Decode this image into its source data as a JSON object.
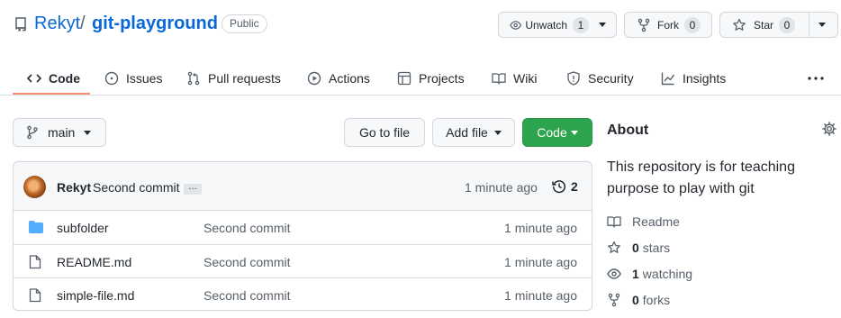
{
  "repo": {
    "owner": "Rekyt",
    "separator": "/",
    "name": "git-playground",
    "visibility": "Public"
  },
  "actions": {
    "watch_label": "Unwatch",
    "watch_count": "1",
    "fork_label": "Fork",
    "fork_count": "0",
    "star_label": "Star",
    "star_count": "0"
  },
  "nav": {
    "tabs": [
      {
        "label": "Code",
        "icon": "code-icon",
        "selected": true
      },
      {
        "label": "Issues",
        "icon": "issue-icon"
      },
      {
        "label": "Pull requests",
        "icon": "pull-request-icon"
      },
      {
        "label": "Actions",
        "icon": "play-icon"
      },
      {
        "label": "Projects",
        "icon": "table-icon"
      },
      {
        "label": "Wiki",
        "icon": "book-icon"
      },
      {
        "label": "Security",
        "icon": "shield-icon"
      },
      {
        "label": "Insights",
        "icon": "graph-icon"
      }
    ],
    "more_icon": "kebab-horizontal-icon"
  },
  "toolbar": {
    "branch": "main",
    "goto_label": "Go to file",
    "addfile_label": "Add file",
    "code_label": "Code"
  },
  "commit": {
    "author": "Rekyt",
    "message": "Second commit",
    "ellipsis": "…",
    "time": "1 minute ago",
    "count": "2"
  },
  "files": [
    {
      "name": "subfolder",
      "type": "directory",
      "message": "Second commit",
      "time": "1 minute ago"
    },
    {
      "name": "README.md",
      "type": "file",
      "message": "Second commit",
      "time": "1 minute ago"
    },
    {
      "name": "simple-file.md",
      "type": "file",
      "message": "Second commit",
      "time": "1 minute ago"
    }
  ],
  "about": {
    "title": "About",
    "description": "This repository is for teaching purpose to play with git",
    "readme_label": "Readme",
    "stars_count": "0",
    "stars_label": "stars",
    "watching_count": "1",
    "watching_label": "watching",
    "forks_count": "0",
    "forks_label": "forks"
  },
  "colors": {
    "link": "#0969da",
    "code_button": "#2da44e",
    "tab_underline": "#fd8c73",
    "folder": "#54aeff"
  }
}
